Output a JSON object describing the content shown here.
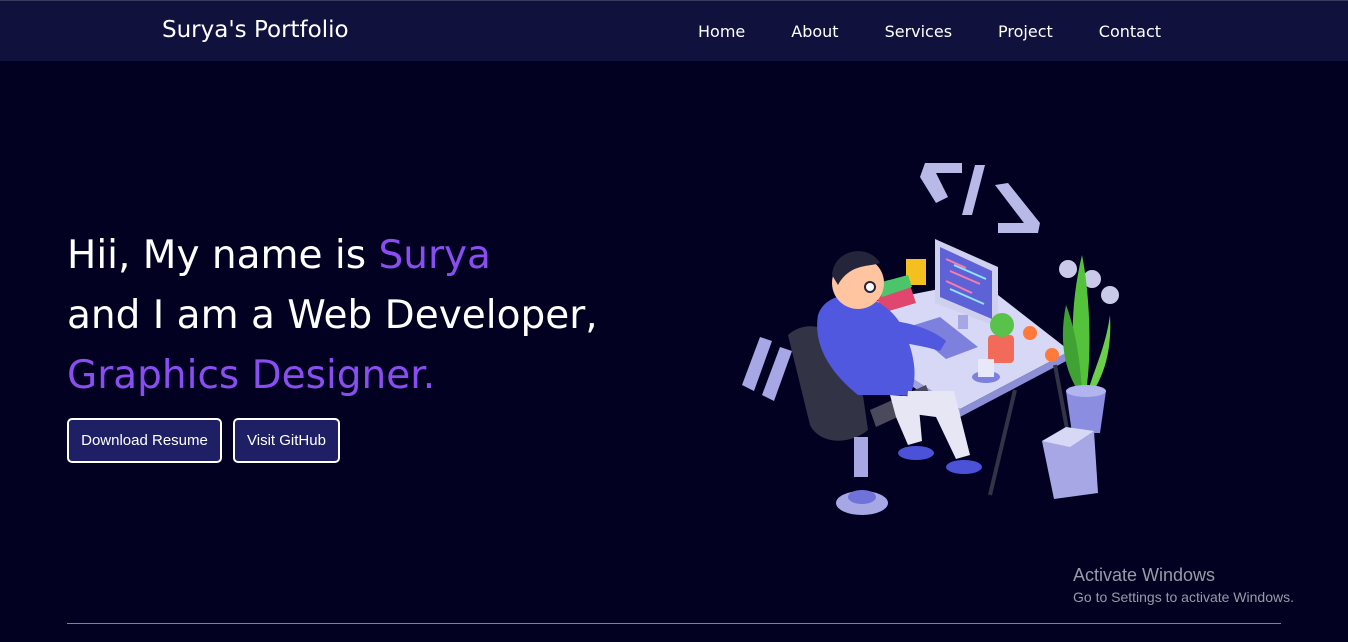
{
  "navbar": {
    "brand": "Surya's Portfolio",
    "links": [
      {
        "label": "Home"
      },
      {
        "label": "About"
      },
      {
        "label": "Services"
      },
      {
        "label": "Project"
      },
      {
        "label": "Contact"
      }
    ]
  },
  "hero": {
    "line1_prefix": "Hii, My name is ",
    "line1_name": "Surya",
    "line2": "and I am a Web Developer,",
    "line3": "Graphics Designer.",
    "buttons": {
      "resume": "Download Resume",
      "github": "Visit GitHub"
    },
    "illustration_icon": "developer-at-desk-illustration"
  },
  "os_watermark": {
    "title": "Activate Windows",
    "subtitle": "Go to Settings to activate Windows."
  },
  "colors": {
    "background": "#020122",
    "navbar": "#11113d",
    "accent": "#8a4ef0",
    "button_bg": "#1f1f66",
    "divider": "#7a7ad0"
  }
}
